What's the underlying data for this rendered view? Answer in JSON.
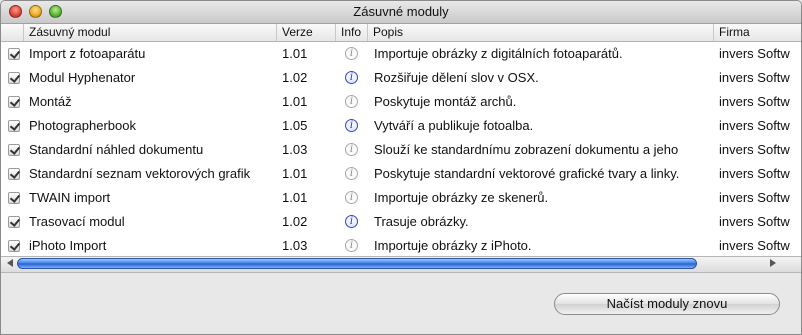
{
  "window": {
    "title": "Zásuvné moduly"
  },
  "table": {
    "columns": [
      "Zásuvný modul",
      "Verze",
      "Info",
      "Popis",
      "Firma"
    ],
    "rows": [
      {
        "enabled": true,
        "name": "Import z fotoaparátu",
        "version": "1.01",
        "info": "inactive",
        "description": "Importuje obrázky z digitálních fotoaparátů.",
        "company": "invers Softw"
      },
      {
        "enabled": true,
        "name": "Modul Hyphenator",
        "version": "1.02",
        "info": "active",
        "description": "Rozšiřuje dělení slov v OSX.",
        "company": "invers Softw"
      },
      {
        "enabled": true,
        "name": "Montáž",
        "version": "1.01",
        "info": "inactive",
        "description": "Poskytuje montáž archů.",
        "company": "invers Softw"
      },
      {
        "enabled": true,
        "name": "Photographerbook",
        "version": "1.05",
        "info": "active",
        "description": "Vytváří a publikuje fotoalba.",
        "company": "invers Softw"
      },
      {
        "enabled": true,
        "name": "Standardní náhled dokumentu",
        "version": "1.03",
        "info": "inactive",
        "description": "Slouží ke standardnímu zobrazení dokumentu a jeho",
        "company": "invers Softw"
      },
      {
        "enabled": true,
        "name": "Standardní seznam vektorových grafik",
        "version": "1.01",
        "info": "inactive",
        "description": "Poskytuje standardní vektorové grafické tvary a linky.",
        "company": "invers Softw"
      },
      {
        "enabled": true,
        "name": "TWAIN import",
        "version": "1.01",
        "info": "inactive",
        "description": "Importuje obrázky ze skenerů.",
        "company": "invers Softw"
      },
      {
        "enabled": true,
        "name": "Trasovací modul",
        "version": "1.02",
        "info": "active",
        "description": "Trasuje obrázky.",
        "company": "invers Softw"
      },
      {
        "enabled": true,
        "name": "iPhoto Import",
        "version": "1.03",
        "info": "inactive",
        "description": "Importuje obrázky z iPhoto.",
        "company": "invers Softw"
      }
    ]
  },
  "buttons": {
    "reload_label": "Načíst moduly znovu"
  },
  "icons": {
    "info": "info-icon",
    "checkbox": "checkmark-icon"
  }
}
